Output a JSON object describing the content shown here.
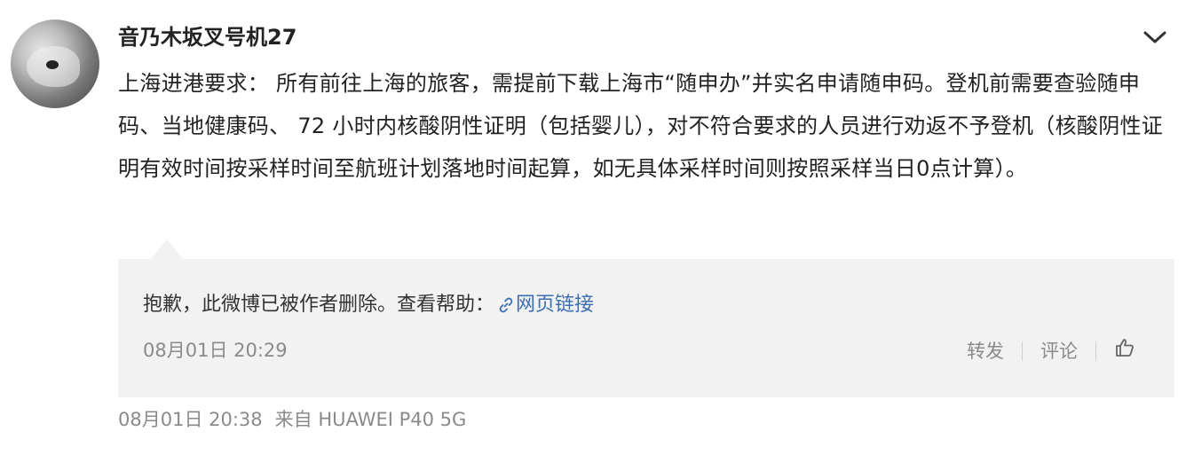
{
  "post": {
    "author": "音乃木坂叉号机27",
    "content": "上海进港要求： 所有前往上海的旅客，需提前下载上海市“随申办”并实名申请随申码。登机前需要查验随申码、当地健康码、 72 小时内核酸阴性证明（包括婴儿），对不符合要求的人员进行劝返不予登机（核酸阴性证明有效时间按采样时间至航班计划落地时间起算，如无具体采样时间则按照采样当日0点计算）。",
    "time": "08月01日 20:38",
    "source": "来自 HUAWEI P40 5G"
  },
  "repost": {
    "deleted_text": "抱歉，此微博已被作者删除。查看帮助：",
    "help_link": "网页链接",
    "time": "08月01日 20:29",
    "actions": {
      "forward": "转发",
      "comment": "评论"
    }
  },
  "icons": {
    "menu": "chevron-down-icon",
    "link": "link-icon",
    "like": "thumbs-up-icon"
  }
}
